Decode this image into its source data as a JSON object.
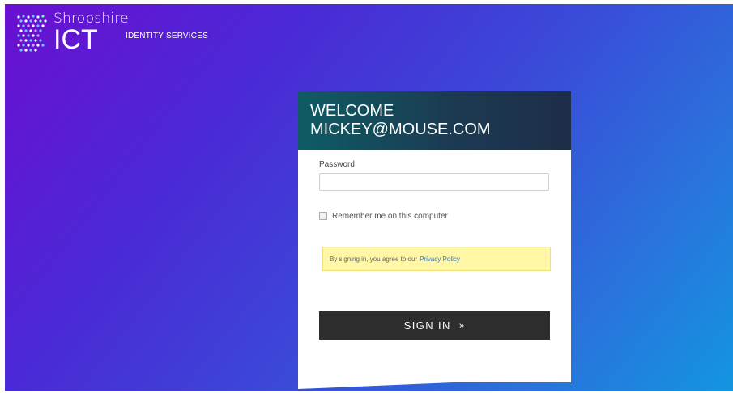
{
  "header": {
    "brand_top": "Shropshire",
    "brand_main": "ICT",
    "service_name": "IDENTITY SERVICES",
    "logo_icon": "dot-grid-logo-icon"
  },
  "card": {
    "welcome": "WELCOME",
    "email": "MICKEY@MOUSE.COM",
    "password_label": "Password",
    "password_value": "",
    "remember_label": "Remember me on this computer",
    "remember_checked": false,
    "notice_text": "By signing in, you agree to our",
    "notice_link": "Privacy Policy",
    "signin_label": "SIGN IN",
    "signin_icon": "»"
  },
  "colors": {
    "background_start": "#6a0fd0",
    "background_end": "#1296e0",
    "card_header": "#1b3b52",
    "signin_button": "#2d2d2d",
    "notice_bg": "#fff6a6",
    "link": "#2a7ad0"
  }
}
